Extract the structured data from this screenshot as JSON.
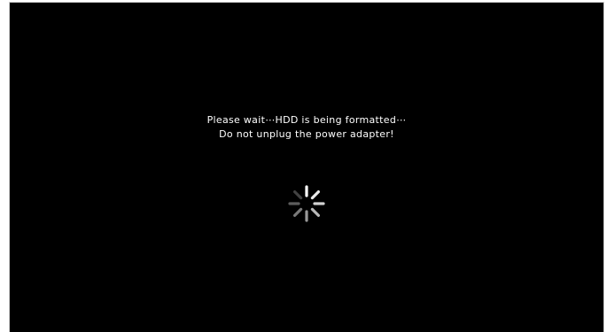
{
  "dialog": {
    "line1": "Please wait⋯HDD is being formatted⋯",
    "line2": "Do not unplug the power adapter!"
  },
  "spinner": {
    "icon": "loading-spinner-icon",
    "color": "#ffffff"
  },
  "colors": {
    "screen_background": "#000000",
    "text": "#ffffff",
    "frame": "#ffffff"
  }
}
